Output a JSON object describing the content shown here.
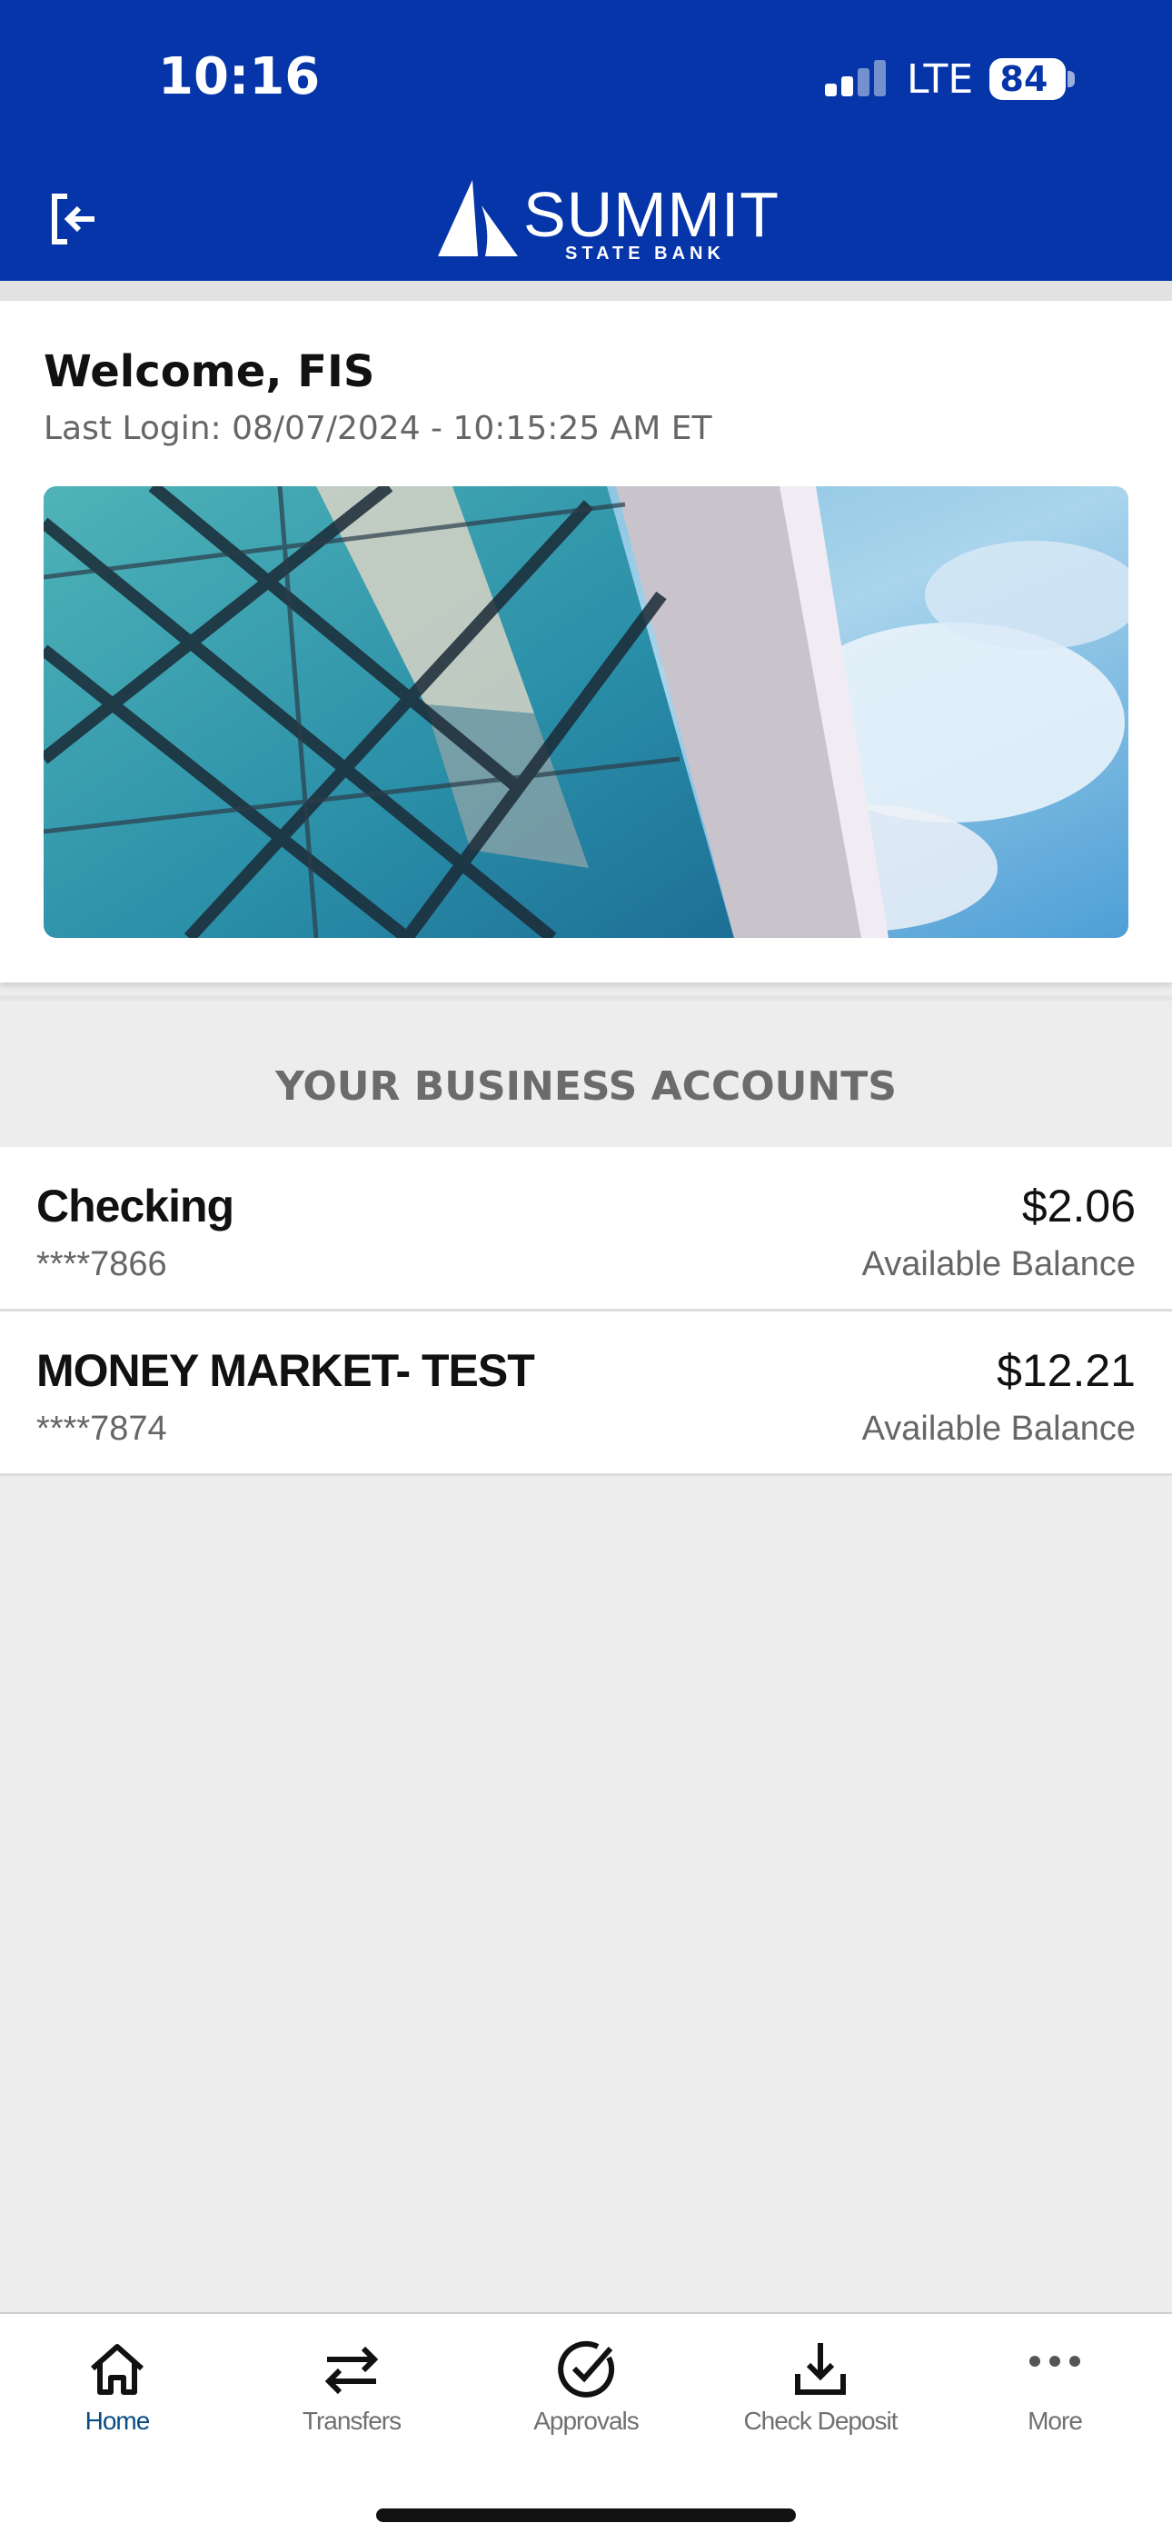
{
  "status_bar": {
    "time": "10:16",
    "network": "LTE",
    "battery": "84"
  },
  "header": {
    "logo_name": "SUMMIT",
    "logo_sub": "STATE BANK",
    "logout_icon": "logout-icon"
  },
  "welcome": {
    "title": "Welcome, FIS",
    "last_login": "Last Login: 08/07/2024 - 10:15:25 AM ET"
  },
  "accounts": {
    "heading": "YOUR BUSINESS ACCOUNTS",
    "items": [
      {
        "name": "Checking",
        "number": "****7866",
        "balance": "$2.06",
        "balance_label": "Available Balance"
      },
      {
        "name": "MONEY MARKET- TEST",
        "number": "****7874",
        "balance": "$12.21",
        "balance_label": "Available Balance"
      }
    ]
  },
  "tabbar": {
    "items": [
      {
        "label": "Home",
        "icon": "home-icon",
        "active": true
      },
      {
        "label": "Transfers",
        "icon": "transfer-arrows-icon",
        "active": false
      },
      {
        "label": "Approvals",
        "icon": "check-circle-icon",
        "active": false
      },
      {
        "label": "Check Deposit",
        "icon": "download-tray-icon",
        "active": false
      },
      {
        "label": "More",
        "icon": "more-dots-icon",
        "active": false
      }
    ]
  },
  "colors": {
    "header_bg": "#0535a8",
    "active_tab": "#0a4b86",
    "background": "#ededed"
  }
}
